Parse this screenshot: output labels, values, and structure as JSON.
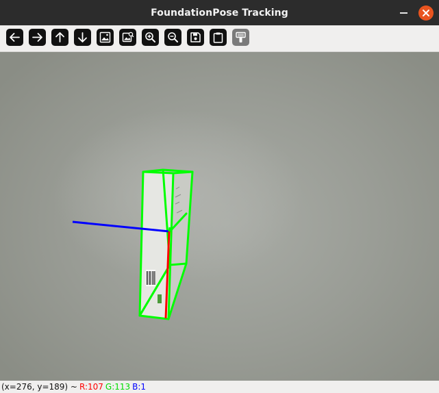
{
  "window": {
    "title": "FoundationPose Tracking"
  },
  "toolbar": {
    "buttons": [
      {
        "icon": "arrow-left-icon",
        "tooltip": ""
      },
      {
        "icon": "arrow-right-icon",
        "tooltip": ""
      },
      {
        "icon": "arrow-up-icon",
        "tooltip": ""
      },
      {
        "icon": "arrow-down-icon",
        "tooltip": ""
      },
      {
        "icon": "image-icon",
        "tooltip": ""
      },
      {
        "icon": "image-zoom-icon",
        "tooltip": ""
      },
      {
        "icon": "zoom-in-icon",
        "tooltip": ""
      },
      {
        "icon": "zoom-out-icon",
        "tooltip": ""
      },
      {
        "icon": "save-icon",
        "tooltip": ""
      },
      {
        "icon": "clipboard-icon",
        "tooltip": ""
      },
      {
        "icon": "properties-icon",
        "tooltip": ""
      }
    ]
  },
  "status": {
    "coords": "(x=276, y=189) ~",
    "r_label": "R:107",
    "g_label": "G:113",
    "b_label": "B:1",
    "r_color": "#ff0000",
    "g_color": "#00dd00",
    "b_color": "#0000ff"
  },
  "overlay": {
    "bbox_color": "#00ff00",
    "axis_x_color": "#ff0000",
    "axis_z_color": "#0000ff"
  }
}
